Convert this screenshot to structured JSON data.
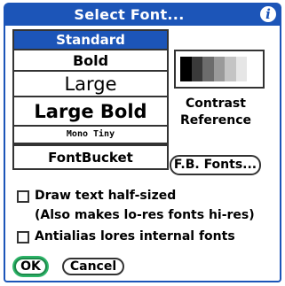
{
  "dialog": {
    "title": "Select Font...",
    "info_icon": "i"
  },
  "font_list": {
    "items": [
      {
        "label": "Standard",
        "selected": true
      },
      {
        "label": "Bold",
        "selected": false
      },
      {
        "label": "Large",
        "selected": false
      },
      {
        "label": "Large Bold",
        "selected": false
      },
      {
        "label": "Mono Tiny",
        "selected": false
      }
    ],
    "fontbucket_label": "FontBucket"
  },
  "contrast": {
    "label": "Contrast Reference",
    "swatches": [
      "#000000",
      "#3a3a3a",
      "#6c6c6c",
      "#9a9a9a",
      "#c4c4c4",
      "#e6e6e6",
      "#ffffff"
    ]
  },
  "fb_fonts_button": "F.B. Fonts...",
  "options": {
    "half_sized_line1": "Draw text half-sized",
    "half_sized_line2": "(Also makes lo-res fonts hi-res)",
    "antialias": "Antialias lores internal fonts"
  },
  "buttons": {
    "ok": "OK",
    "cancel": "Cancel"
  },
  "colors": {
    "accent": "#1c55b8",
    "ok_highlight": "#2fb56a"
  }
}
